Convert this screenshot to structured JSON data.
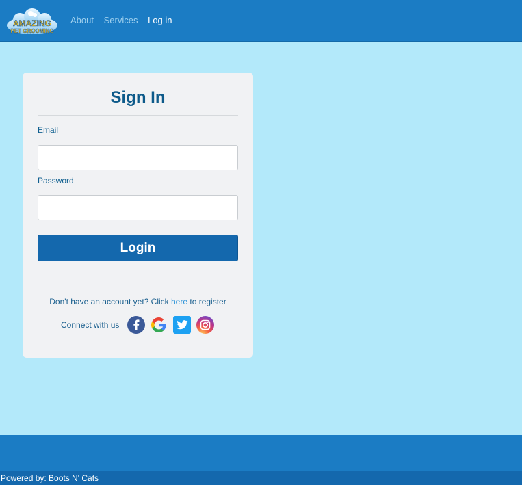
{
  "brand": {
    "logo_line1": "AMAZING",
    "logo_line2": "PET GROOMING"
  },
  "nav": {
    "about": "About",
    "services": "Services",
    "login": "Log in"
  },
  "form": {
    "title": "Sign In",
    "email_label": "Email",
    "email_value": "",
    "password_label": "Password",
    "password_value": "",
    "login_button": "Login"
  },
  "register": {
    "prefix": "Don't have an account yet? Click ",
    "link": "here",
    "suffix": " to register"
  },
  "social": {
    "connect_label": "Connect with us",
    "icons": [
      "facebook-icon",
      "google-icon",
      "twitter-icon",
      "instagram-icon"
    ]
  },
  "footer": {
    "powered_by": "Powered by: Boots N' Cats"
  },
  "colors": {
    "page_bg": "#b3e9fa",
    "navbar": "#1b7cc4",
    "primary_button": "#1468ad",
    "title": "#0d5a8a",
    "link": "#2c93d8"
  }
}
